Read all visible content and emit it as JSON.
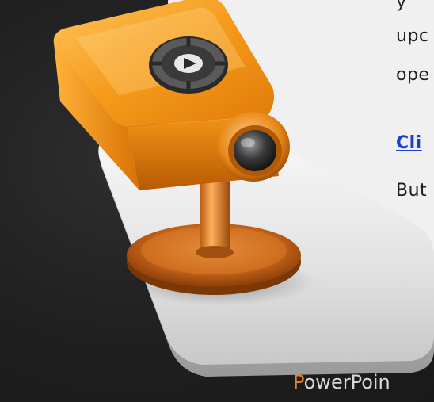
{
  "panel": {
    "lines": [
      "y",
      "upc",
      "ope",
      "Cli",
      "But"
    ]
  },
  "app_name": {
    "first_letter": "P",
    "rest": "owerPoin"
  },
  "colors": {
    "background": "#222222",
    "panel": "#f0f0f0",
    "link": "#1a3fd6",
    "accent": "#e8821a",
    "projector_orange": "#f08a12"
  },
  "icons": {
    "app_icon": "projector-icon"
  }
}
